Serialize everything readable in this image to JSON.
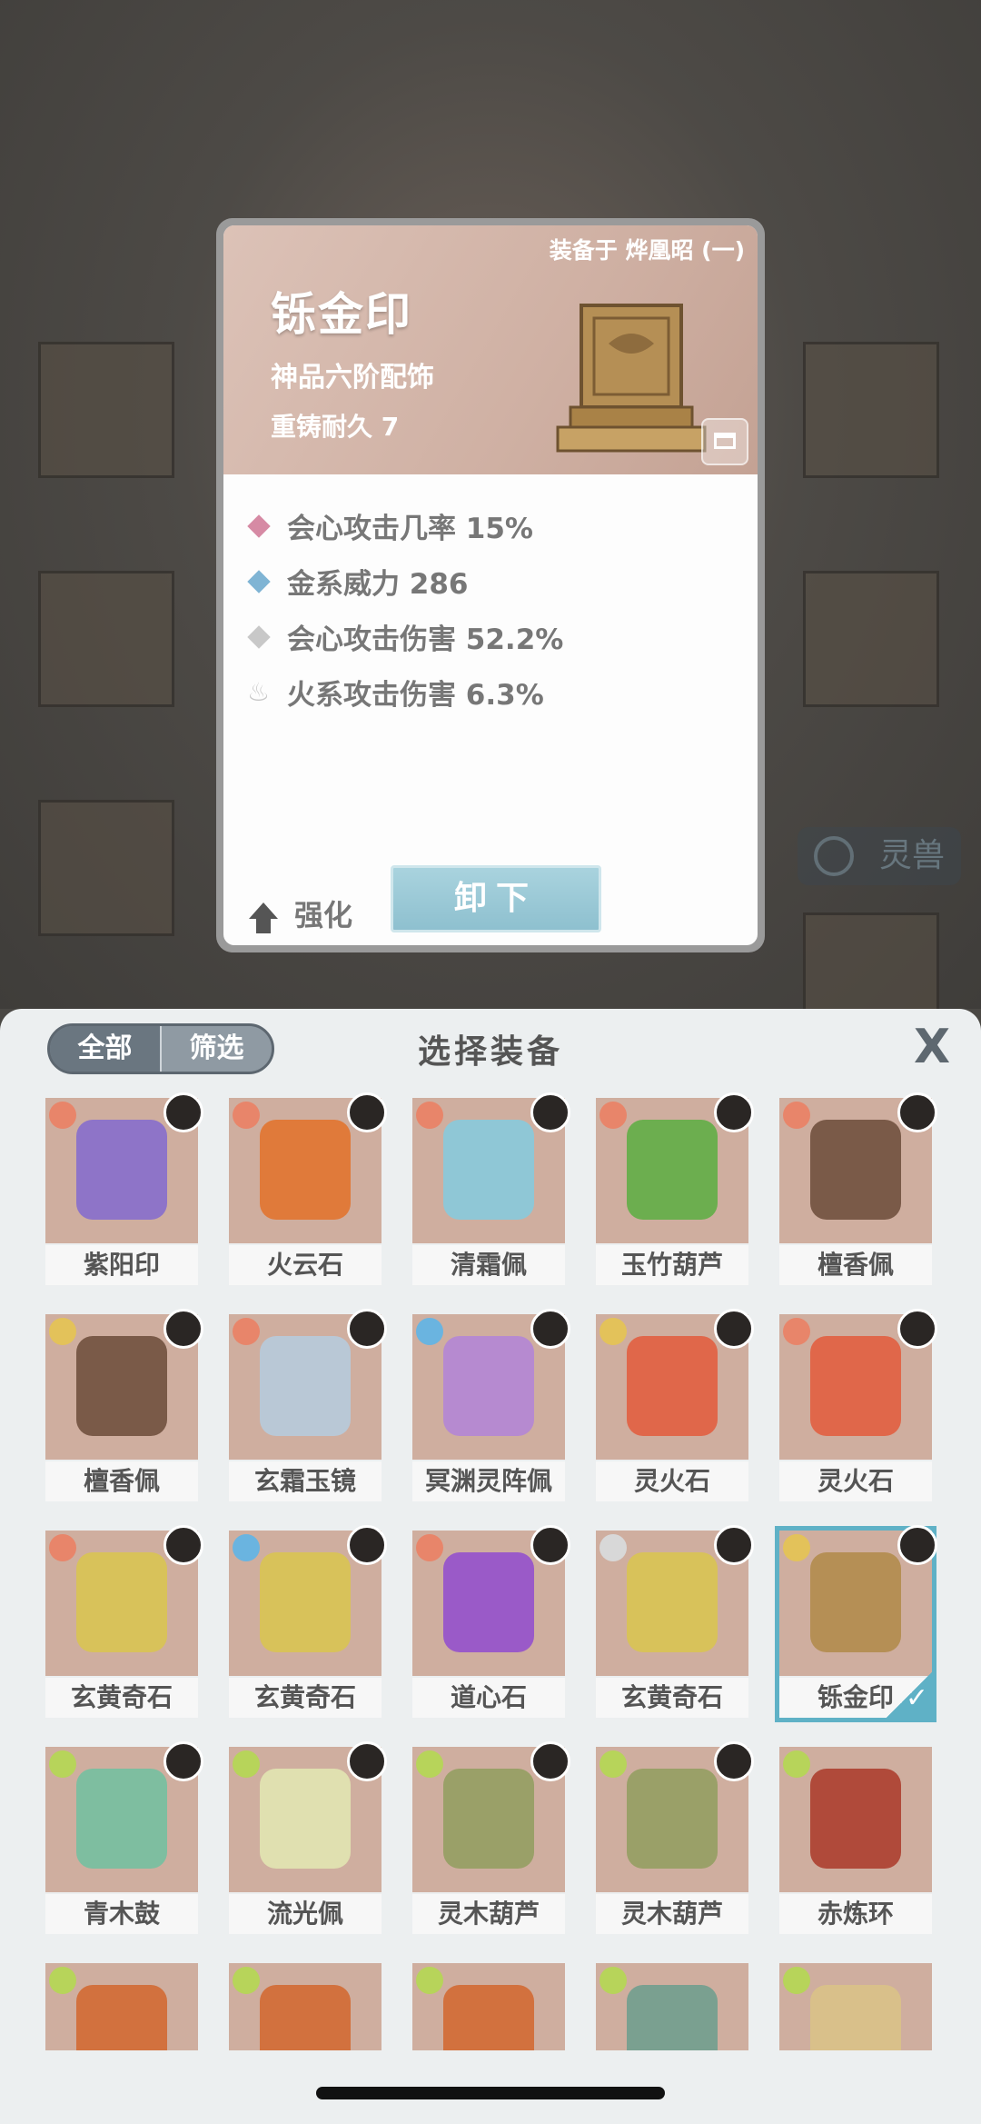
{
  "detail": {
    "equipped_on": "装备于 烨凰昭 (一)",
    "name": "铄金印",
    "grade": "神品六阶配饰",
    "reforge": "重铸耐久 7",
    "stats": [
      {
        "text": "会心攻击几率 15%",
        "color": "#d68aa4"
      },
      {
        "text": "金系威力 286",
        "color": "#7fb4d4"
      },
      {
        "text": "会心攻击伤害 52.2%",
        "color": "#c8c8c8"
      },
      {
        "text": "火系攻击伤害 6.3%",
        "color": "#c8c8c8"
      }
    ],
    "enhance_label": "强化",
    "unequip_label": "卸下"
  },
  "background": {
    "tag_label": "灵兽"
  },
  "sheet": {
    "filter_all": "全部",
    "filter_select": "筛选",
    "title": "选择装备",
    "close": "X"
  },
  "items": [
    {
      "name": "紫阳印",
      "elem": "#e8856a",
      "art": "#8e74c8"
    },
    {
      "name": "火云石",
      "elem": "#e8856a",
      "art": "#e07a3a"
    },
    {
      "name": "清霜佩",
      "elem": "#e8856a",
      "art": "#8fc7d6"
    },
    {
      "name": "玉竹葫芦",
      "elem": "#e8856a",
      "art": "#6cae4f"
    },
    {
      "name": "檀香佩",
      "elem": "#e8856a",
      "art": "#7a5a48"
    },
    {
      "name": "檀香佩",
      "elem": "#e3c25a",
      "art": "#7a5a48"
    },
    {
      "name": "玄霜玉镜",
      "elem": "#e8856a",
      "art": "#b9c8d6"
    },
    {
      "name": "冥渊灵阵佩",
      "elem": "#6ab4e0",
      "art": "#b68ad0"
    },
    {
      "name": "灵火石",
      "elem": "#e3c25a",
      "art": "#e0674a"
    },
    {
      "name": "灵火石",
      "elem": "#e8856a",
      "art": "#e0674a"
    },
    {
      "name": "玄黄奇石",
      "elem": "#e8856a",
      "art": "#d8c25a"
    },
    {
      "name": "玄黄奇石",
      "elem": "#6ab4e0",
      "art": "#d8c25a"
    },
    {
      "name": "道心石",
      "elem": "#e8856a",
      "art": "#9a5ac8"
    },
    {
      "name": "玄黄奇石",
      "elem": "#d8d8d8",
      "art": "#d8c25a"
    },
    {
      "name": "铄金印",
      "elem": "#e3c25a",
      "art": "#b58f55"
    },
    {
      "name": "青木鼓",
      "elem": "#b7d45a",
      "art": "#7ebea0"
    },
    {
      "name": "流光佩",
      "elem": "#b7d45a",
      "art": "#e0e0b0"
    },
    {
      "name": "灵木葫芦",
      "elem": "#b7d45a",
      "art": "#9aa068"
    },
    {
      "name": "灵木葫芦",
      "elem": "#b7d45a",
      "art": "#9aa068"
    },
    {
      "name": "赤炼环",
      "elem": "#b7d45a",
      "art": "#b04a3a"
    },
    {
      "name": "",
      "elem": "#b7d45a",
      "art": "#d2713e"
    },
    {
      "name": "",
      "elem": "#b7d45a",
      "art": "#d2713e"
    },
    {
      "name": "",
      "elem": "#b7d45a",
      "art": "#d2713e"
    },
    {
      "name": "",
      "elem": "#b7d45a",
      "art": "#7aa090"
    },
    {
      "name": "",
      "elem": "#b7d45a",
      "art": "#d9c08a"
    }
  ]
}
